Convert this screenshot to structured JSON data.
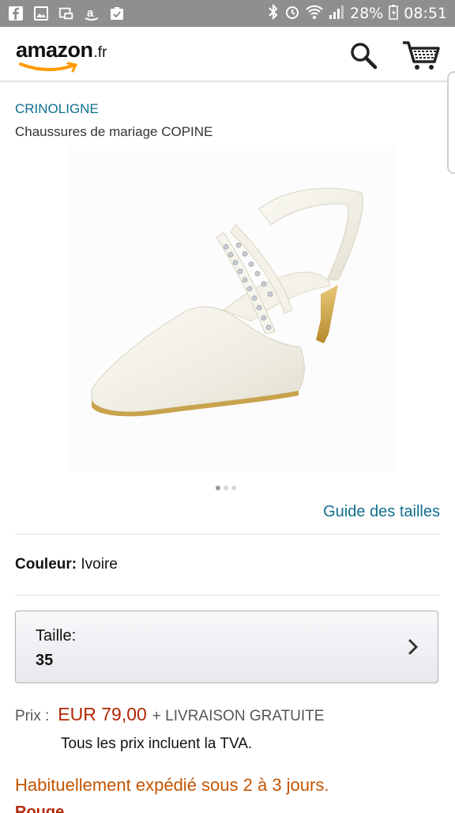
{
  "status_bar": {
    "battery": "28%",
    "time": "08:51",
    "icons": [
      "facebook-icon",
      "gallery-icon",
      "screenshot-icon",
      "amazon-app-icon",
      "clipboard-icon",
      "bluetooth-icon",
      "alarm-icon",
      "wifi-icon",
      "signal-icon",
      "battery-icon"
    ]
  },
  "header": {
    "logo_text": "amazon",
    "logo_tld": ".fr",
    "accent": "#ff9900"
  },
  "product": {
    "brand": "CRINOLIGNE",
    "title": "Chaussures de mariage COPINE",
    "image_name": "white-wedding-shoe",
    "image_count": 3,
    "image_current": 1,
    "size_guide": "Guide des tailles"
  },
  "color": {
    "label": "Couleur:",
    "value": "Ivoire"
  },
  "size": {
    "label": "Taille:",
    "value": "35"
  },
  "price": {
    "label": "Prix :",
    "value": "EUR 79,00",
    "shipping": "+ LIVRAISON GRATUITE",
    "tva_note": "Tous les prix incluent la TVA.",
    "price_color": "#b12704"
  },
  "availability": {
    "text": "Habituellement expédié sous 2 à 3 jours.",
    "color": "#c45500"
  },
  "cutoff_line": "Rouge"
}
